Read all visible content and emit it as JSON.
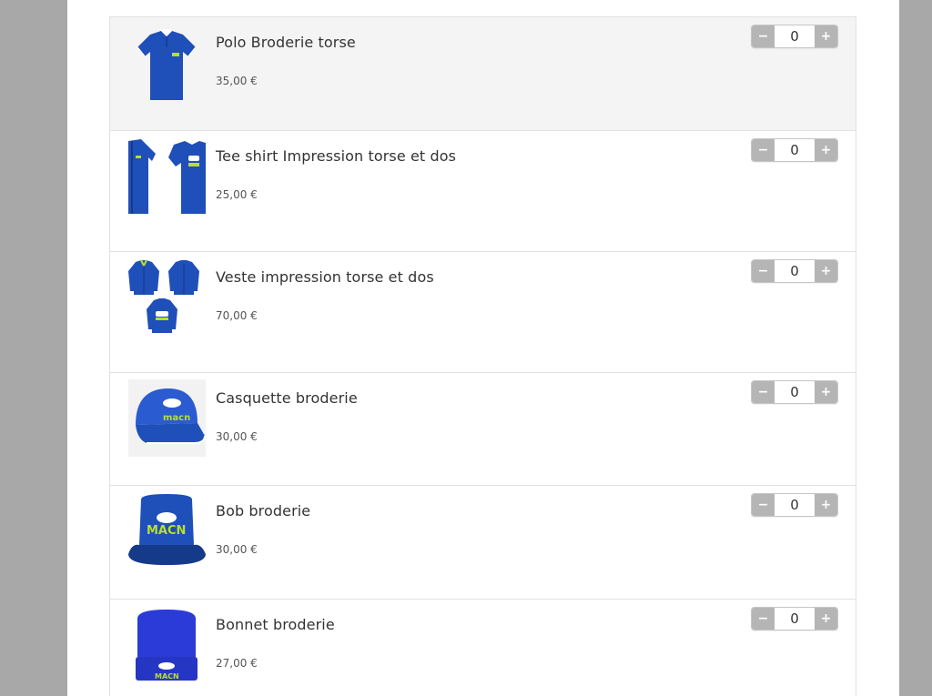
{
  "colors": {
    "background": "#a8a8a8",
    "panel": "#ffffff",
    "row_highlight": "#f4f4f4",
    "stepper_button": "#b5b5b5",
    "product_blue": "#1f4fb8",
    "logo_green": "#b8e02a"
  },
  "stepper": {
    "minus_label": "−",
    "plus_label": "+"
  },
  "products": [
    {
      "name": "Polo Broderie torse",
      "price": "35,00 €",
      "quantity": "0",
      "icon": "polo-shirt-icon"
    },
    {
      "name": "Tee shirt Impression torse et dos",
      "price": "25,00 €",
      "quantity": "0",
      "icon": "tee-shirt-icon"
    },
    {
      "name": "Veste impression torse et dos",
      "price": "70,00 €",
      "quantity": "0",
      "icon": "jacket-icon"
    },
    {
      "name": "Casquette broderie",
      "price": "30,00 €",
      "quantity": "0",
      "icon": "cap-icon"
    },
    {
      "name": "Bob broderie",
      "price": "30,00 €",
      "quantity": "0",
      "icon": "bucket-hat-icon"
    },
    {
      "name": "Bonnet broderie",
      "price": "27,00 €",
      "quantity": "0",
      "icon": "beanie-icon"
    }
  ]
}
